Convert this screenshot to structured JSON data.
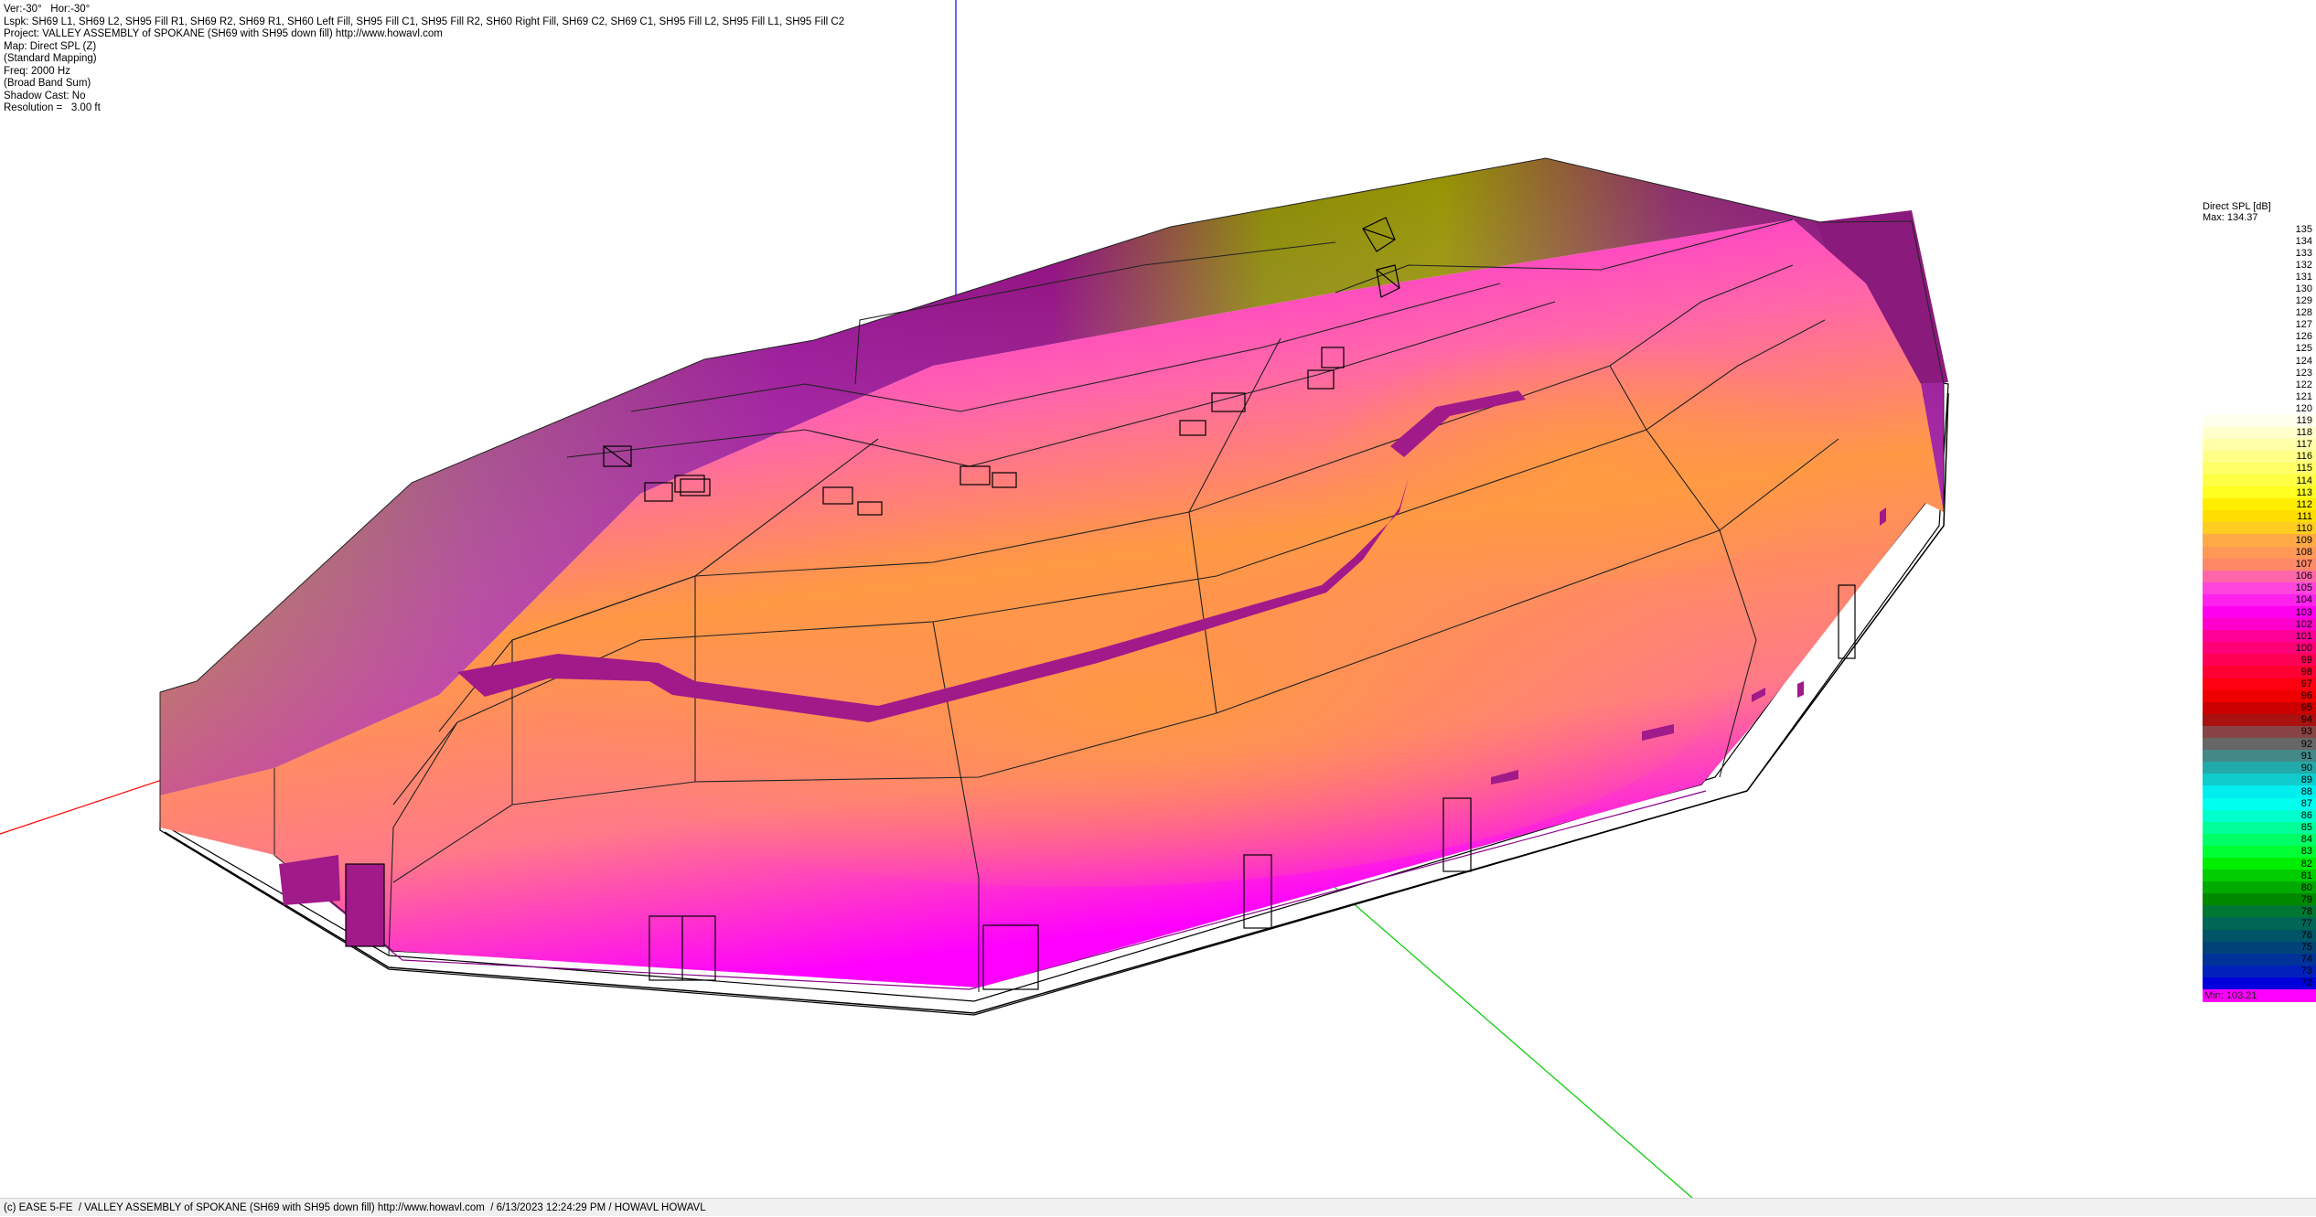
{
  "info_lines": [
    "Ver:-30°   Hor:-30°",
    "Lspk: SH69 L1, SH69 L2, SH95 Fill R1, SH69 R2, SH69 R1, SH60 Left Fill, SH95 Fill C1, SH95 Fill R2, SH60 Right Fill, SH69 C2, SH69 C1, SH95 Fill L2, SH95 Fill L1, SH95 Fill C2",
    "Project: VALLEY ASSEMBLY of SPOKANE (SH69 with SH95 down fill) http://www.howavl.com",
    "Map: Direct SPL (Z)",
    "(Standard Mapping)",
    "Freq: 2000 Hz",
    "(Broad Band Sum)",
    "Shadow Cast: No",
    "Resolution =   3.00 ft"
  ],
  "legend": {
    "title": "Direct SPL [dB]",
    "max_label": "Max:  134.37",
    "min_label": "Min:  103.21",
    "levels": [
      {
        "value": "135",
        "color": "#ffffff"
      },
      {
        "value": "134",
        "color": "#ffffff"
      },
      {
        "value": "133",
        "color": "#ffffff"
      },
      {
        "value": "132",
        "color": "#ffffff"
      },
      {
        "value": "131",
        "color": "#ffffff"
      },
      {
        "value": "130",
        "color": "#ffffff"
      },
      {
        "value": "129",
        "color": "#ffffff"
      },
      {
        "value": "128",
        "color": "#ffffff"
      },
      {
        "value": "127",
        "color": "#ffffff"
      },
      {
        "value": "126",
        "color": "#ffffff"
      },
      {
        "value": "125",
        "color": "#ffffff"
      },
      {
        "value": "124",
        "color": "#ffffff"
      },
      {
        "value": "123",
        "color": "#ffffff"
      },
      {
        "value": "122",
        "color": "#ffffff"
      },
      {
        "value": "121",
        "color": "#ffffff"
      },
      {
        "value": "120",
        "color": "#ffffff"
      },
      {
        "value": "119",
        "color": "#ffffee"
      },
      {
        "value": "118",
        "color": "#ffffcc"
      },
      {
        "value": "117",
        "color": "#ffffaa"
      },
      {
        "value": "116",
        "color": "#ffff88"
      },
      {
        "value": "115",
        "color": "#ffff66"
      },
      {
        "value": "114",
        "color": "#ffff44"
      },
      {
        "value": "113",
        "color": "#ffff22"
      },
      {
        "value": "112",
        "color": "#ffee00"
      },
      {
        "value": "111",
        "color": "#ffdd00"
      },
      {
        "value": "110",
        "color": "#ffcc22"
      },
      {
        "value": "109",
        "color": "#ffaa44"
      },
      {
        "value": "108",
        "color": "#ff9955"
      },
      {
        "value": "107",
        "color": "#ff8866"
      },
      {
        "value": "106",
        "color": "#ff66aa"
      },
      {
        "value": "105",
        "color": "#ff44dd"
      },
      {
        "value": "104",
        "color": "#ff22ee"
      },
      {
        "value": "103",
        "color": "#ff00ee"
      },
      {
        "value": "102",
        "color": "#ff00cc"
      },
      {
        "value": "101",
        "color": "#ff0099"
      },
      {
        "value": "100",
        "color": "#ff0077"
      },
      {
        "value": "99",
        "color": "#ff0055"
      },
      {
        "value": "98",
        "color": "#ff0033"
      },
      {
        "value": "97",
        "color": "#ff0011"
      },
      {
        "value": "96",
        "color": "#ee0000"
      },
      {
        "value": "95",
        "color": "#cc0000"
      },
      {
        "value": "94",
        "color": "#aa1111"
      },
      {
        "value": "93",
        "color": "#884444"
      },
      {
        "value": "92",
        "color": "#666666"
      },
      {
        "value": "91",
        "color": "#448888"
      },
      {
        "value": "90",
        "color": "#22aaaa"
      },
      {
        "value": "89",
        "color": "#11cccc"
      },
      {
        "value": "88",
        "color": "#00eeee"
      },
      {
        "value": "87",
        "color": "#00ffee"
      },
      {
        "value": "86",
        "color": "#00ffcc"
      },
      {
        "value": "85",
        "color": "#00ff99"
      },
      {
        "value": "84",
        "color": "#00ff66"
      },
      {
        "value": "83",
        "color": "#00ff33"
      },
      {
        "value": "82",
        "color": "#00ee00"
      },
      {
        "value": "81",
        "color": "#00cc00"
      },
      {
        "value": "80",
        "color": "#00aa00"
      },
      {
        "value": "79",
        "color": "#008800"
      },
      {
        "value": "78",
        "color": "#007733"
      },
      {
        "value": "77",
        "color": "#006655"
      },
      {
        "value": "76",
        "color": "#005566"
      },
      {
        "value": "75",
        "color": "#004477"
      },
      {
        "value": "74",
        "color": "#003399"
      },
      {
        "value": "73",
        "color": "#0022bb"
      },
      {
        "value": "72",
        "color": "#0000dd"
      }
    ]
  },
  "status_bar": "(c) EASE 5-FE  / VALLEY ASSEMBLY of SPOKANE (SH69 with SH95 down fill) http://www.howavl.com  / 6/13/2023 12:24:29 PM / HOWAVL HOWAVL",
  "colors": {
    "axis_x": "#ff0000",
    "axis_y": "#00cc00",
    "axis_z": "#0000ff",
    "magenta": "#ff00ff",
    "orange": "#ff9944",
    "purple": "#880088",
    "olive": "#888800"
  },
  "icons": [
    "loudspeaker-icon"
  ]
}
